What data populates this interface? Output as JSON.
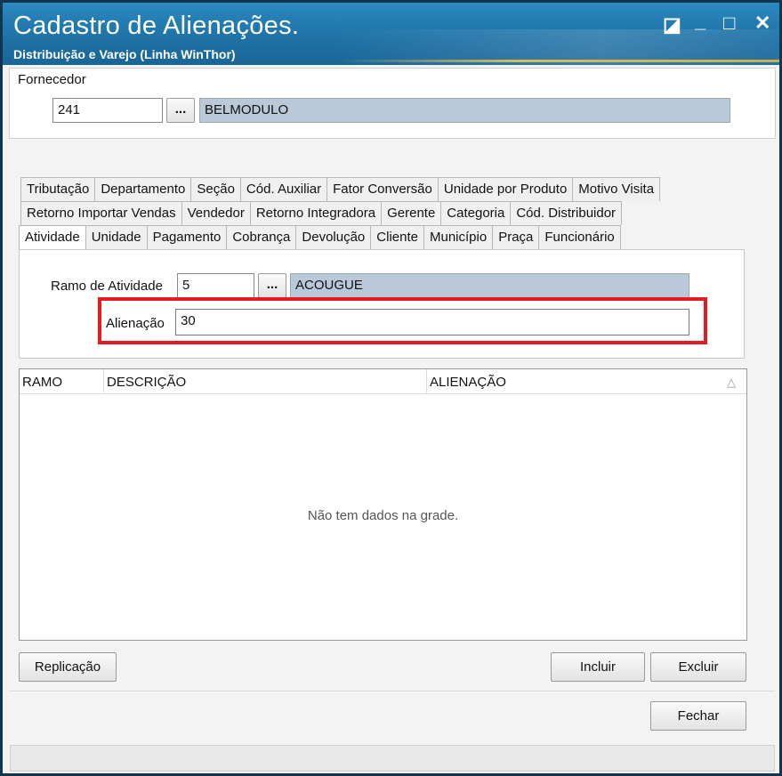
{
  "window": {
    "title": "Cadastro de Alienações.",
    "subtitle": "Distribuição e Varejo (Linha WinThor)",
    "controls": {
      "restore": "◪",
      "minimize": "_",
      "maximize": "□",
      "close": "✕"
    }
  },
  "fornecedor": {
    "label": "Fornecedor",
    "code": "241",
    "lookup_label": "...",
    "name": "BELMODULO"
  },
  "tabs": {
    "row1": [
      "Tributação",
      "Departamento",
      "Seção",
      "Cód. Auxiliar",
      "Fator Conversão",
      "Unidade por Produto",
      "Motivo Visita"
    ],
    "row2": [
      "Retorno Importar Vendas",
      "Vendedor",
      "Retorno Integradora",
      "Gerente",
      "Categoria",
      "Cód. Distribuidor"
    ],
    "row3": [
      "Atividade",
      "Unidade",
      "Pagamento",
      "Cobrança",
      "Devolução",
      "Cliente",
      "Município",
      "Praça",
      "Funcionário"
    ],
    "active": "Atividade"
  },
  "atividade": {
    "ramo_label": "Ramo de Atividade",
    "ramo_code": "5",
    "lookup_label": "...",
    "ramo_name": "ACOUGUE",
    "alienacao_label": "Alienação",
    "alienacao_value": "30"
  },
  "grid": {
    "columns": [
      "RAMO",
      "DESCRIÇÃO",
      "ALIENAÇÃO"
    ],
    "sort_indicator": "△",
    "empty_message": "Não tem dados na grade."
  },
  "buttons": {
    "replicacao": "Replicação",
    "incluir": "Incluir",
    "excluir": "Excluir",
    "fechar": "Fechar"
  },
  "colors": {
    "titlebar": "#1f73a7",
    "highlight": "#e41b23",
    "readonly_field": "#b9c9d9"
  }
}
